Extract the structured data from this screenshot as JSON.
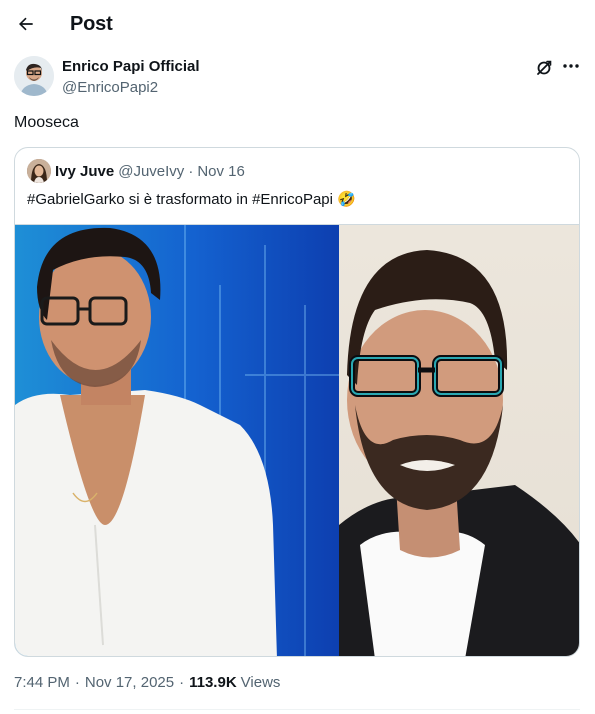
{
  "header": {
    "title": "Post"
  },
  "post": {
    "author": {
      "name": "Enrico Papi Official",
      "handle": "@EnricoPapi2"
    },
    "text": "Mooseca",
    "quote": {
      "author_name": "Ivy Juve",
      "author_handle": "@JuveIvy",
      "separator": "·",
      "date": "Nov 16",
      "text": "#GabrielGarko si è trasformato in #EnricoPapi 🤣"
    },
    "meta": {
      "time": "7:44 PM",
      "date": "Nov 17, 2025",
      "views_count": "113.9K",
      "views_label": "Views",
      "separator": "·"
    }
  },
  "icons": {
    "back": "arrow-left-icon",
    "grok": "grok-icon",
    "more": "more-horizontal-icon"
  },
  "colors": {
    "text_primary": "#0f1419",
    "text_secondary": "#536471",
    "border": "#cfd9de"
  }
}
